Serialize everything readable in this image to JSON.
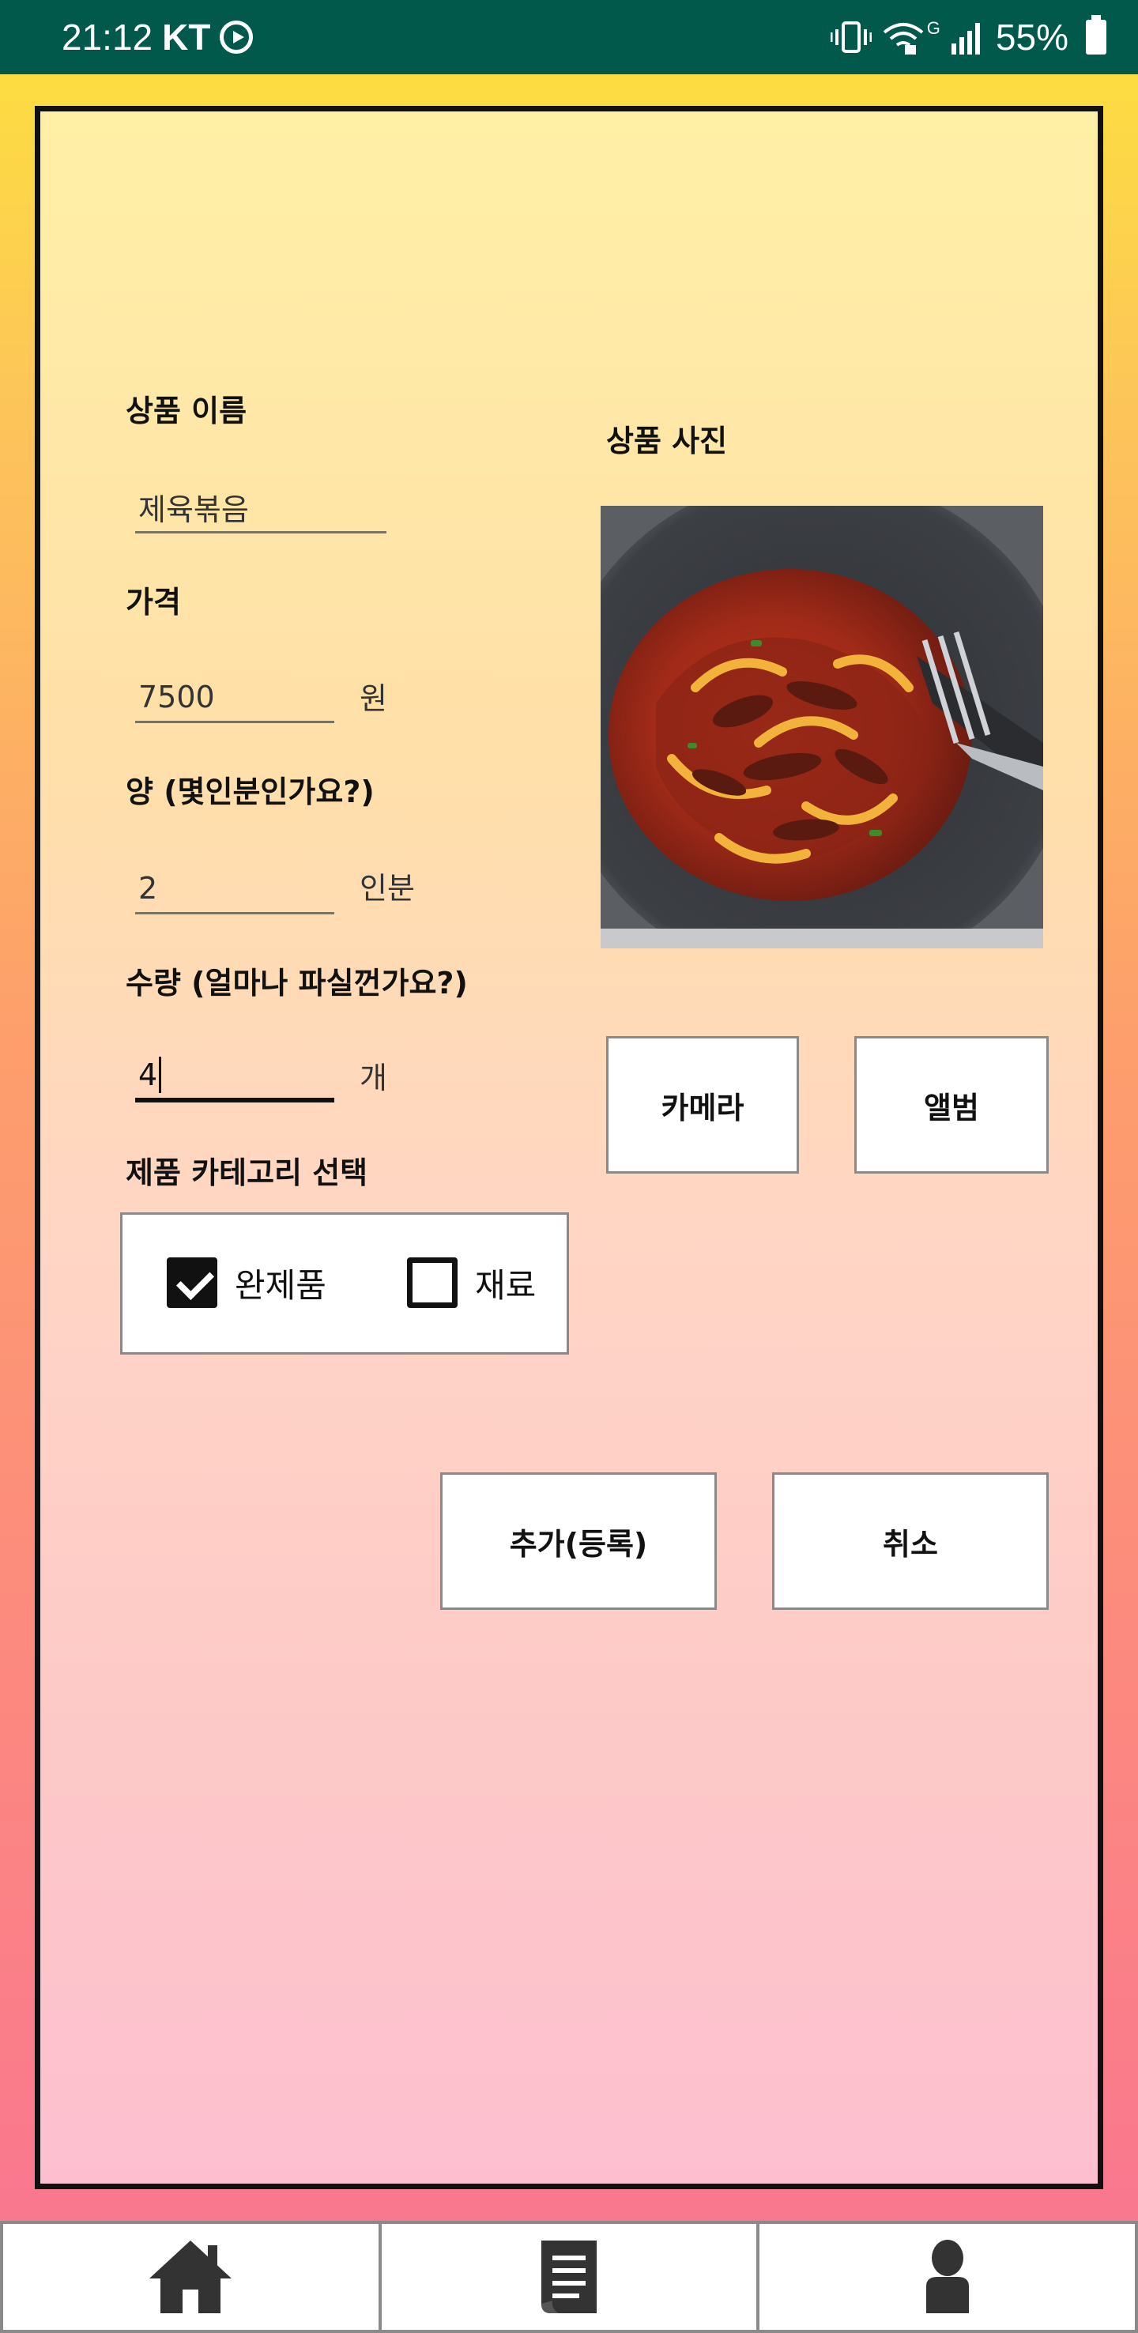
{
  "status_bar": {
    "time": "21:12",
    "carrier": "KT",
    "network_badge": "G",
    "battery": "55%"
  },
  "form": {
    "name_label": "상품 이름",
    "name_value": "제육볶음",
    "price_label": "가격",
    "price_value": "7500",
    "price_unit": "원",
    "portion_label": "양 (몇인분인가요?)",
    "portion_value": "2",
    "portion_unit": "인분",
    "quantity_label": "수량 (얼마나 파실껀가요?)",
    "quantity_value": "4",
    "quantity_unit": "개",
    "category_label": "제품 카테고리 선택",
    "category_options": [
      {
        "label": "완제품",
        "checked": true
      },
      {
        "label": "재료",
        "checked": false
      }
    ]
  },
  "photo": {
    "label": "상품 사진",
    "camera_button": "카메라",
    "album_button": "앨범"
  },
  "actions": {
    "add_button": "추가(등록)",
    "cancel_button": "취소"
  },
  "bottom_nav": {
    "tabs": [
      {
        "icon": "home-icon"
      },
      {
        "icon": "document-list-icon"
      },
      {
        "icon": "person-icon"
      }
    ]
  },
  "colors": {
    "status_bar": "#00594a",
    "accent_border": "#111111"
  }
}
